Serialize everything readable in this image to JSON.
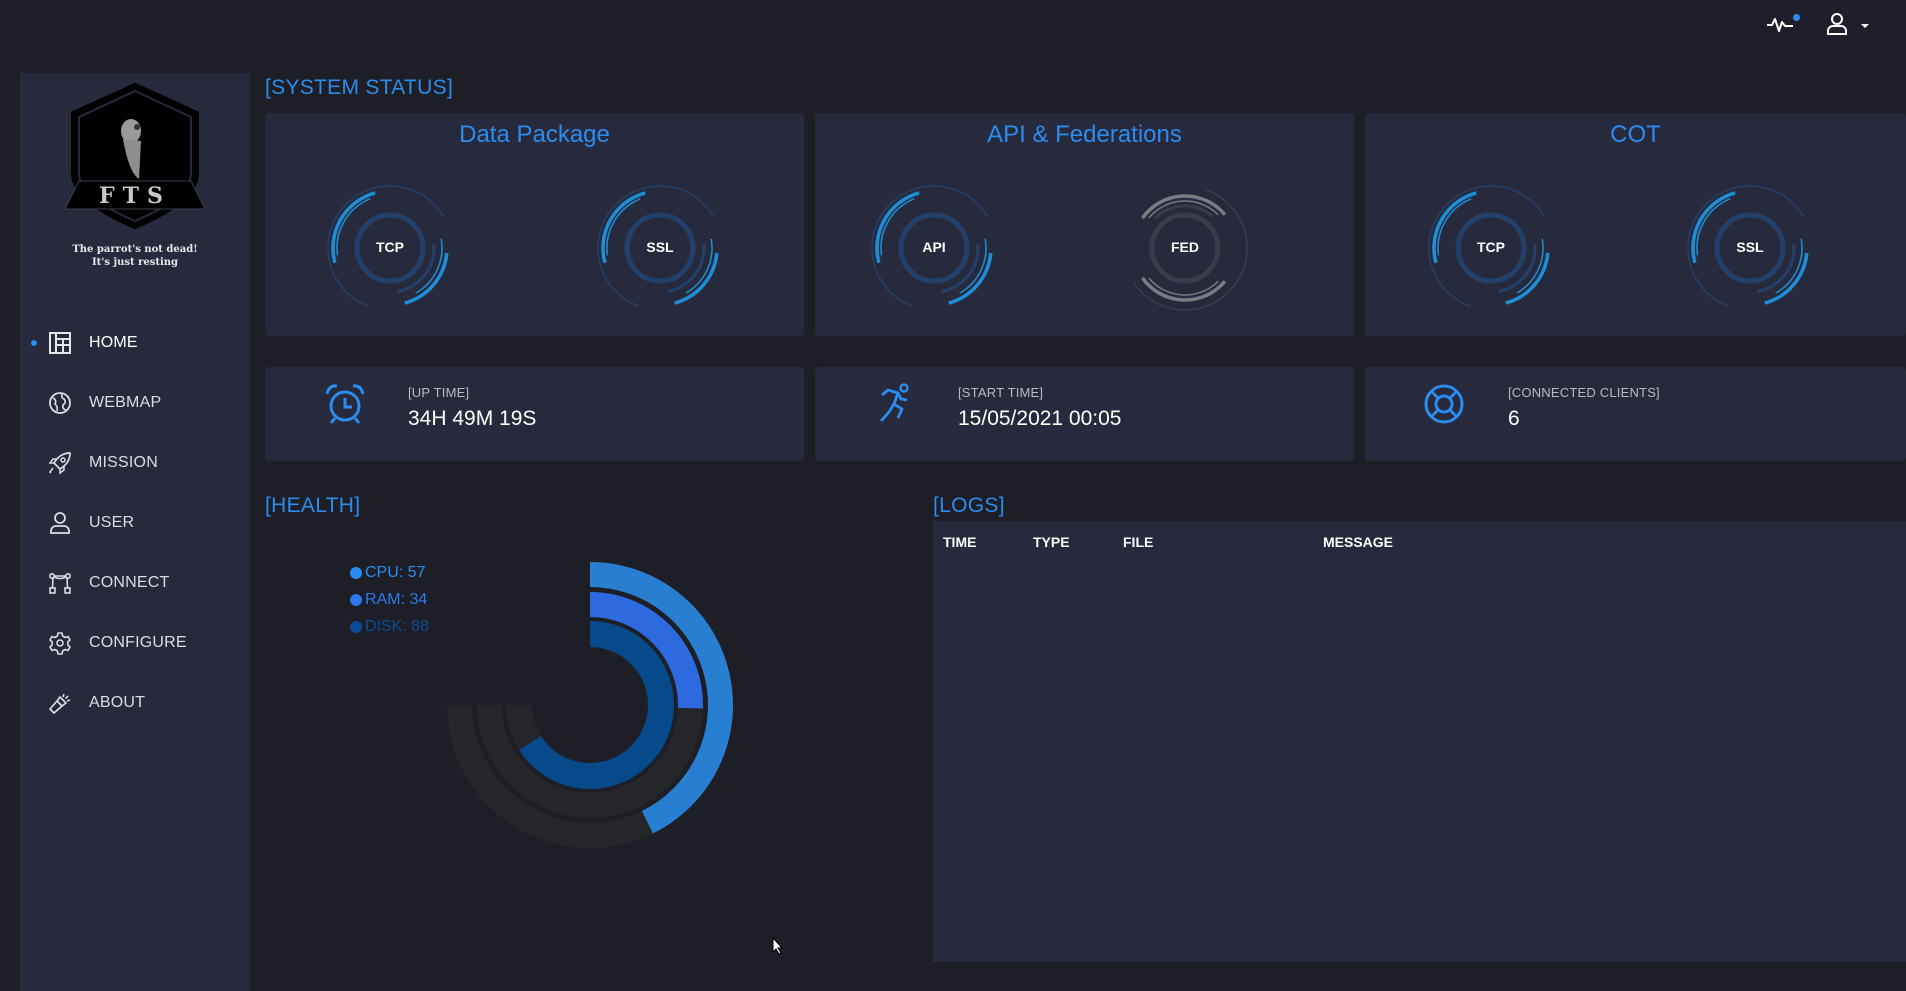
{
  "header": {
    "activity_icon": "pulse-icon",
    "notification_dot": true,
    "user_icon": "user-icon",
    "user_menu_icon": "caret-down-icon"
  },
  "sidebar": {
    "logo_text": "FTS",
    "tagline_line1": "The parrot's not dead!",
    "tagline_line2": "It's just resting",
    "items": [
      {
        "label": "HOME",
        "icon": "dashboard-icon",
        "active": true
      },
      {
        "label": "WEBMAP",
        "icon": "globe-icon",
        "active": false
      },
      {
        "label": "MISSION",
        "icon": "rocket-icon",
        "active": false
      },
      {
        "label": "USER",
        "icon": "user-icon",
        "active": false
      },
      {
        "label": "CONNECT",
        "icon": "nodes-icon",
        "active": false
      },
      {
        "label": "CONFIGURE",
        "icon": "gear-icon",
        "active": false
      },
      {
        "label": "ABOUT",
        "icon": "flashlight-icon",
        "active": false
      }
    ]
  },
  "system_status": {
    "title": "[SYSTEM STATUS]",
    "cards": [
      {
        "title": "Data Package",
        "gauges": [
          {
            "label": "TCP",
            "state": "active"
          },
          {
            "label": "SSL",
            "state": "active"
          }
        ]
      },
      {
        "title": "API & Federations",
        "gauges": [
          {
            "label": "API",
            "state": "active"
          },
          {
            "label": "FED",
            "state": "inactive"
          }
        ]
      },
      {
        "title": "COT",
        "gauges": [
          {
            "label": "TCP",
            "state": "active"
          },
          {
            "label": "SSL",
            "state": "active"
          }
        ]
      }
    ]
  },
  "stats": [
    {
      "label": "[UP TIME]",
      "value": "34H 49M 19S",
      "icon": "alarm-clock-icon"
    },
    {
      "label": "[START TIME]",
      "value": "15/05/2021 00:05",
      "icon": "running-man-icon"
    },
    {
      "label": "[CONNECTED CLIENTS]",
      "value": "6",
      "icon": "lifebuoy-icon"
    }
  ],
  "health": {
    "title": "[HEALTH]",
    "legend": [
      {
        "text": "CPU: 57",
        "color": "#2b8cf0"
      },
      {
        "text": "RAM: 34",
        "color": "#2e77f0"
      },
      {
        "text": "DISK: 88",
        "color": "#0b4a99"
      }
    ]
  },
  "chart_data": {
    "type": "radialBar",
    "title": "[HEALTH]",
    "categories": [
      "CPU",
      "RAM",
      "DISK"
    ],
    "values": [
      57,
      34,
      88
    ],
    "max": 100,
    "arc_degrees": 270,
    "colors": [
      "#287ed0",
      "#2d6ae0",
      "#064a8c"
    ],
    "track_color": "#252629",
    "legend_position": "top-left"
  },
  "logs": {
    "title": "[LOGS]",
    "columns": [
      "TIME",
      "TYPE",
      "FILE",
      "MESSAGE"
    ],
    "rows": []
  },
  "colors": {
    "accent": "#2b8cf0",
    "background": "#1e1f26",
    "panel": "#272a3d",
    "inactive": "#7a7a80"
  }
}
